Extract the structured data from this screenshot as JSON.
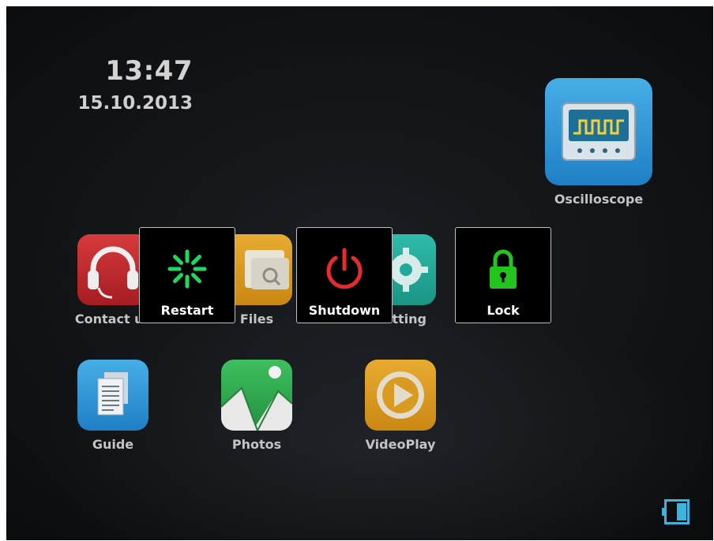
{
  "status": {
    "time": "13:47",
    "date": "15.10.2013"
  },
  "apps": {
    "oscilloscope": "Oscilloscope",
    "contact": "Contact us",
    "files": "Files",
    "setting": "Setting",
    "guide": "Guide",
    "photos": "Photos",
    "videoplay": "VideoPlay"
  },
  "power_menu": {
    "restart": "Restart",
    "shutdown": "Shutdown",
    "lock": "Lock"
  },
  "colors": {
    "restart_icon": "#1ed760",
    "shutdown_icon": "#e52b2b",
    "lock_icon": "#22c41e",
    "oscilloscope_tile": "#2a8fd0",
    "contact_tile": "#c0282c",
    "files_tile": "#d99a22",
    "setting_tile": "#23a99a",
    "guide_tile": "#2a8fd0",
    "photos_tile": "#34a853",
    "videoplay_tile": "#d99a22",
    "battery": "#3fb3e0"
  },
  "icons": {
    "restart": "spinner-icon",
    "shutdown": "power-icon",
    "lock": "padlock-icon",
    "battery": "battery-icon"
  }
}
